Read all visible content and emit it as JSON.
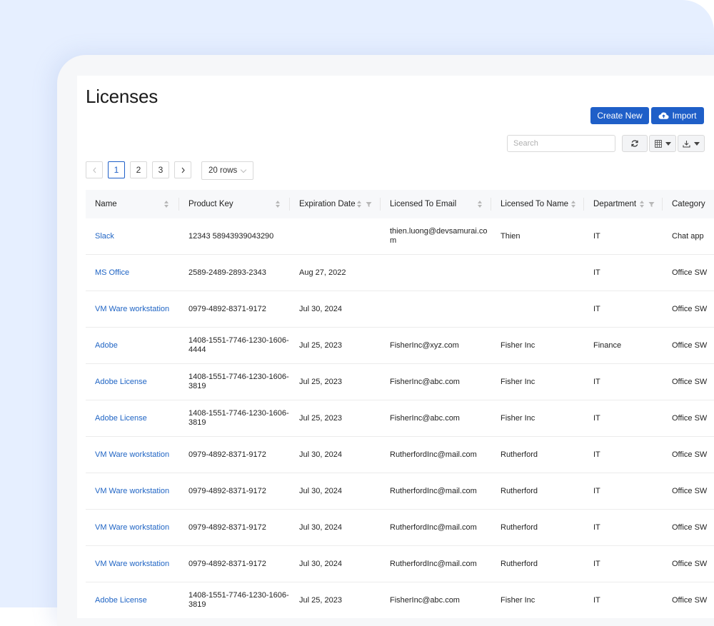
{
  "page": {
    "title": "Licenses"
  },
  "toolbar": {
    "create_label": "Create New",
    "import_label": "Import",
    "search_placeholder": "Search"
  },
  "pagination": {
    "pages": [
      "1",
      "2",
      "3"
    ],
    "current": "1",
    "rows_label": "20 rows"
  },
  "icons": {
    "refresh": "refresh-icon",
    "columns": "columns-icon",
    "download": "download-icon",
    "cloud_upload": "cloud-upload-icon",
    "prev": "chevron-left-icon",
    "next": "chevron-right-icon"
  },
  "colors": {
    "accent": "#1f5fc8",
    "link": "#1f64c4",
    "background": "#e6efff"
  },
  "table": {
    "columns": [
      "Name",
      "Product Key",
      "Expiration Date",
      "Licensed To Email",
      "Licensed To Name",
      "Department",
      "Category"
    ],
    "rows": [
      [
        "Slack",
        "12343 58943939043290",
        "",
        "thien.luong@devsamurai.com",
        "Thien",
        "IT",
        "Chat app"
      ],
      [
        "MS Office",
        "2589-2489-2893-2343",
        "Aug 27, 2022",
        "",
        "",
        "IT",
        "Office SW"
      ],
      [
        "VM Ware workstation",
        "0979-4892-8371-9172",
        "Jul 30, 2024",
        "",
        "",
        "IT",
        "Office SW"
      ],
      [
        "Adobe",
        "1408-1551-7746-1230-1606-4444",
        "Jul 25, 2023",
        "FisherInc@xyz.com",
        "Fisher Inc",
        "Finance",
        "Office SW"
      ],
      [
        "Adobe License",
        "1408-1551-7746-1230-1606-3819",
        "Jul 25, 2023",
        "FisherInc@abc.com",
        "Fisher Inc",
        "IT",
        "Office SW"
      ],
      [
        "Adobe License",
        "1408-1551-7746-1230-1606-3819",
        "Jul 25, 2023",
        "FisherInc@abc.com",
        "Fisher Inc",
        "IT",
        "Office SW"
      ],
      [
        "VM Ware workstation",
        "0979-4892-8371-9172",
        "Jul 30, 2024",
        "RutherfordInc@mail.com",
        "Rutherford",
        "IT",
        "Office SW"
      ],
      [
        "VM Ware workstation",
        "0979-4892-8371-9172",
        "Jul 30, 2024",
        "RutherfordInc@mail.com",
        "Rutherford",
        "IT",
        "Office SW"
      ],
      [
        "VM Ware workstation",
        "0979-4892-8371-9172",
        "Jul 30, 2024",
        "RutherfordInc@mail.com",
        "Rutherford",
        "IT",
        "Office SW"
      ],
      [
        "VM Ware workstation",
        "0979-4892-8371-9172",
        "Jul 30, 2024",
        "RutherfordInc@mail.com",
        "Rutherford",
        "IT",
        "Office SW"
      ],
      [
        "Adobe License",
        "1408-1551-7746-1230-1606-3819",
        "Jul 25, 2023",
        "FisherInc@abc.com",
        "Fisher Inc",
        "IT",
        "Office SW"
      ]
    ]
  }
}
